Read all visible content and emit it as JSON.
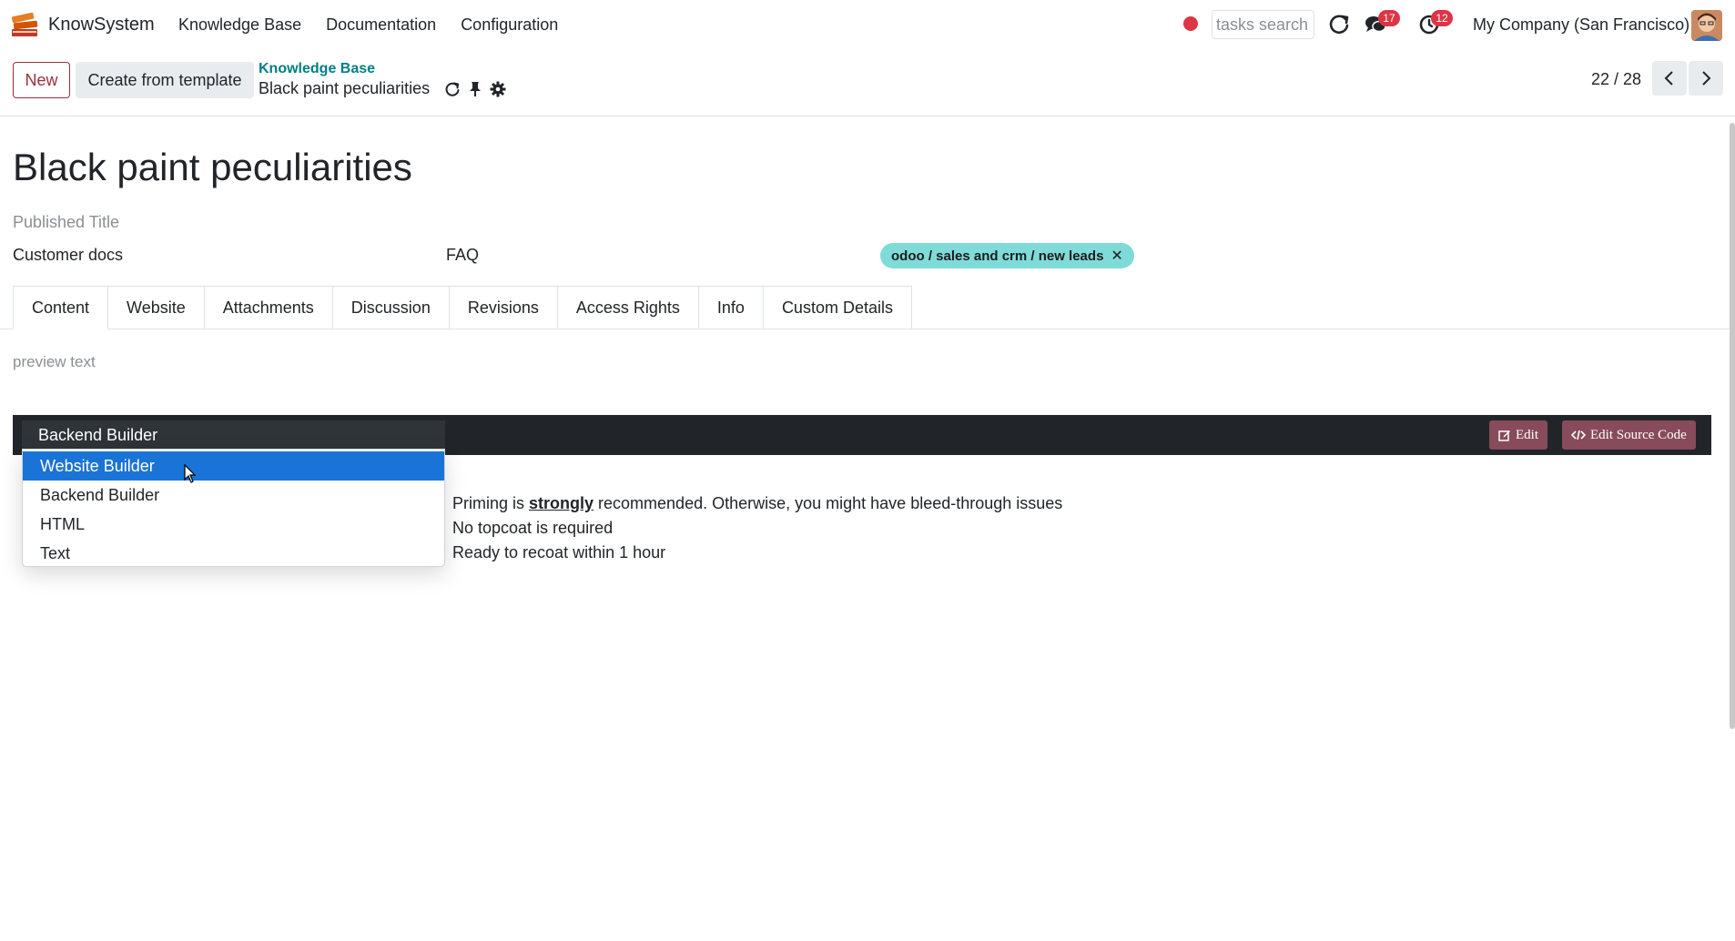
{
  "navbar": {
    "app_name": "KnowSystem",
    "menu": [
      "Knowledge Base",
      "Documentation",
      "Configuration"
    ],
    "search_placeholder": "tasks search",
    "messages_count": "17",
    "activities_count": "12",
    "company": "My Company (San Francisco)"
  },
  "control": {
    "new_label": "New",
    "template_label": "Create from template",
    "breadcrumb_parent": "Knowledge Base",
    "breadcrumb_current": "Black paint peculiarities",
    "pager": "22 / 28"
  },
  "form": {
    "title": "Black paint peculiarities",
    "published_title_placeholder": "Published Title",
    "section": "Customer docs",
    "type": "FAQ",
    "tag": "odoo / sales and crm / new leads",
    "tabs": [
      "Content",
      "Website",
      "Attachments",
      "Discussion",
      "Revisions",
      "Access Rights",
      "Info",
      "Custom Details"
    ],
    "active_tab": "Content",
    "preview_placeholder": "preview text"
  },
  "editor": {
    "selected_mode": "Backend Builder",
    "options": [
      "Website Builder",
      "Backend Builder",
      "HTML",
      "Text"
    ],
    "highlighted_option": "Website Builder",
    "edit_label": "Edit",
    "edit_source_label": "Edit Source Code",
    "accent_color": "#874b5b"
  },
  "content": {
    "line1_prefix": "Priming is ",
    "line1_bold": "strongly",
    "line1_suffix": " recommended. Otherwise, you might have bleed-through issues",
    "line2": "No topcoat is required",
    "line3": "Ready to recoat within 1 hour"
  }
}
